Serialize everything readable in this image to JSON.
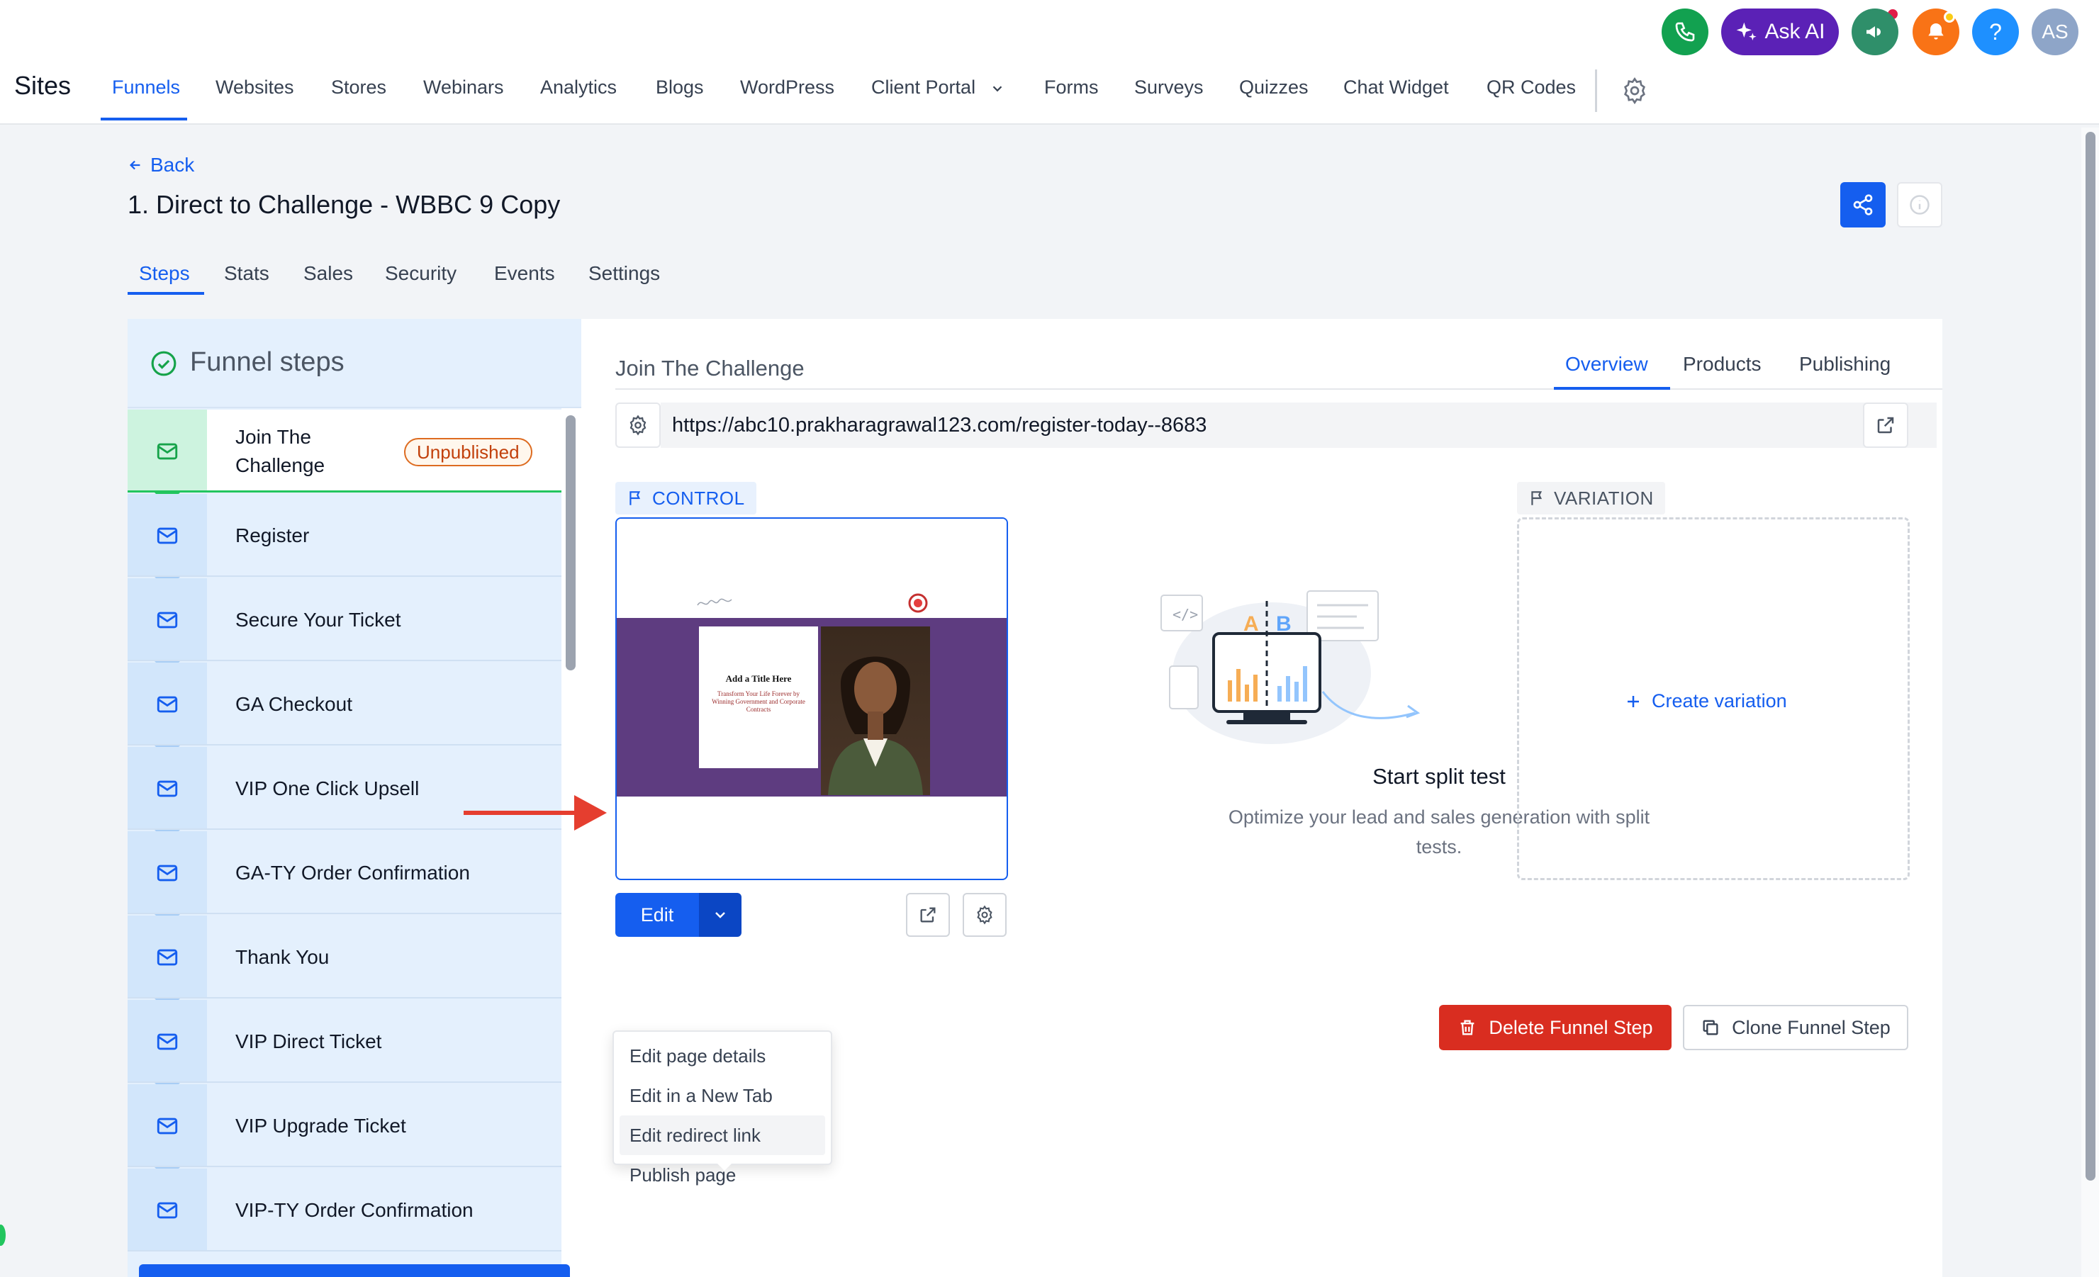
{
  "header": {
    "ask_ai_label": "Ask AI",
    "avatar_initials": "AS",
    "help_label": "?",
    "app_title": "Sites",
    "nav_items": [
      "Funnels",
      "Websites",
      "Stores",
      "Webinars",
      "Analytics",
      "Blogs",
      "WordPress",
      "Client Portal",
      "Forms",
      "Surveys",
      "Quizzes",
      "Chat Widget",
      "QR Codes"
    ],
    "active_nav": "Funnels",
    "icons": [
      "phone-icon",
      "sparkle-icon",
      "megaphone-icon",
      "bell-icon",
      "help-icon",
      "gear-icon"
    ],
    "colors": {
      "phone": "#12a150",
      "ask_ai": "#5b21b6",
      "megaphone": "#2f8f6a",
      "bell": "#f97316",
      "help": "#1e90ff",
      "avatar": "#8ea5c8"
    }
  },
  "page": {
    "back_label": "Back",
    "title": "1. Direct to Challenge - WBBC 9 Copy",
    "tabs": [
      "Steps",
      "Stats",
      "Sales",
      "Security",
      "Events",
      "Settings"
    ],
    "active_tab": "Steps"
  },
  "funnel_steps": {
    "title": "Funnel steps",
    "steps": [
      {
        "label": "Join The Challenge",
        "badge": "Unpublished",
        "active": true
      },
      {
        "label": "Register"
      },
      {
        "label": "Secure Your Ticket"
      },
      {
        "label": "GA Checkout"
      },
      {
        "label": "VIP One Click Upsell"
      },
      {
        "label": "GA-TY Order Confirmation"
      },
      {
        "label": "Thank You"
      },
      {
        "label": "VIP Direct Ticket"
      },
      {
        "label": "VIP Upgrade Ticket"
      },
      {
        "label": "VIP-TY Order Confirmation"
      }
    ]
  },
  "step_detail": {
    "name": "Join The Challenge",
    "tabs": [
      "Overview",
      "Products",
      "Publishing"
    ],
    "active_tab": "Overview",
    "url": "https://abc10.prakharagrawal123.com/register-today--8683",
    "control_label": "CONTROL",
    "variation_label": "VARIATION",
    "thumbnail": {
      "title": "Add a Title Here",
      "subtitle": "Transform Your Life Forever by Winning Government and Corporate Contracts"
    },
    "edit_label": "Edit",
    "menu_items": [
      "Edit page details",
      "Edit in a New Tab",
      "Edit redirect link",
      "Publish page"
    ],
    "hovered_menu_item": "Edit redirect link",
    "split_test": {
      "title": "Start split test",
      "description": "Optimize your lead and sales generation with split tests.",
      "ab_letters": [
        "A",
        "B"
      ]
    },
    "create_variation_label": "Create variation",
    "delete_label": "Delete Funnel Step",
    "clone_label": "Clone Funnel Step"
  },
  "colors": {
    "primary": "#155eef",
    "danger": "#d92d20",
    "badge": "#dd6b20",
    "annotation_arrow": "#e53e2f"
  }
}
